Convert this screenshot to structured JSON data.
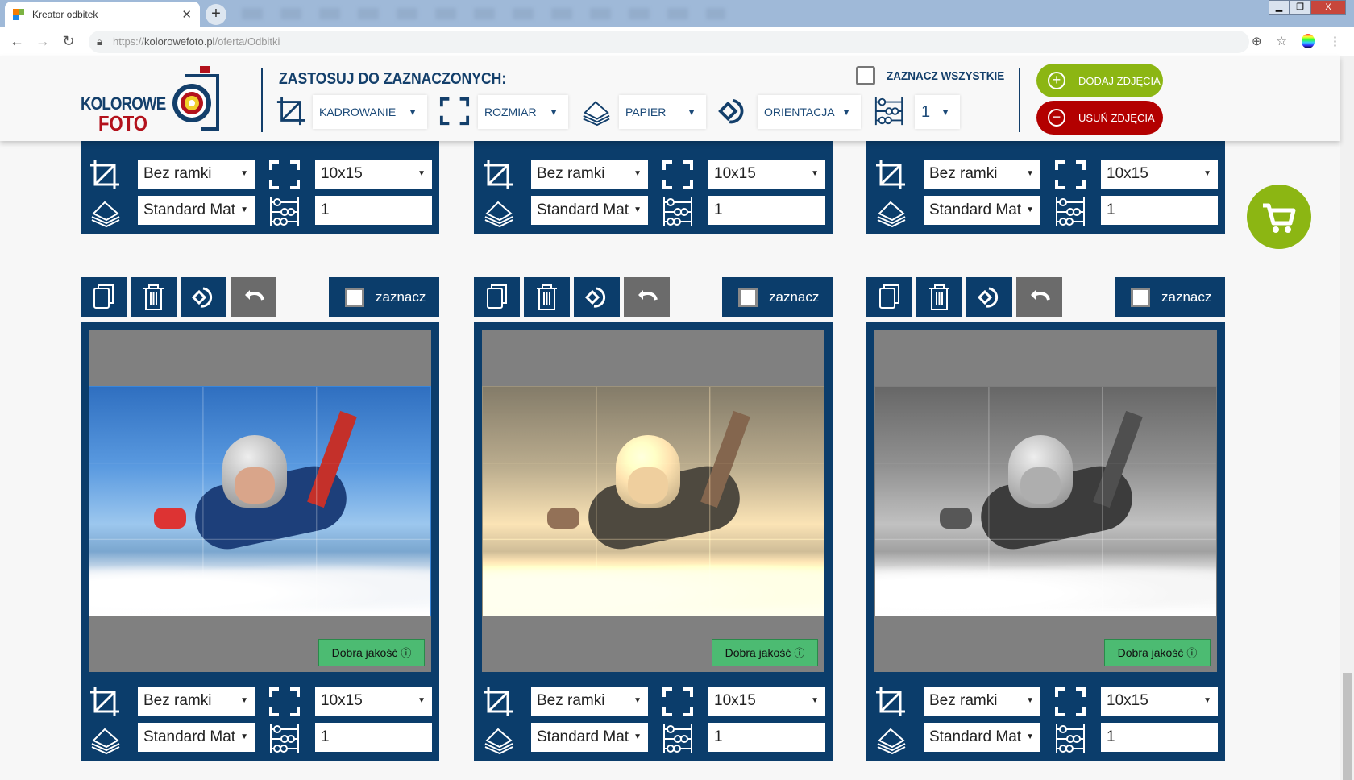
{
  "browser": {
    "tab_title": "Kreator odbitek",
    "url_scheme": "https://",
    "url_host": "kolorowefoto.pl",
    "url_path": "/oferta/Odbitki"
  },
  "logo": {
    "line1": "KOLOROWE",
    "line2": "FOTO"
  },
  "header": {
    "apply_title": "ZASTOSUJ DO ZAZNACZONYCH:",
    "crop_select": "KADROWANIE",
    "size_select": "ROZMIAR",
    "paper_select": "PAPIER",
    "orientation_select": "ORIENTACJA",
    "quantity": "1",
    "select_all": "ZAZNACZ WSZYSTKIE",
    "add_photos": "DODAJ ZDJĘCIA",
    "remove_photos": "USUŃ ZDJĘCIA"
  },
  "colors": {
    "navy": "#0b3d6b",
    "green": "#8cb613",
    "red": "#b30000",
    "quality": "#4cbb72"
  },
  "top_cards": [
    {
      "frame": "Bez ramki",
      "size": "10x15",
      "paper": "Standard Mat",
      "quantity": "1"
    },
    {
      "frame": "Bez ramki",
      "size": "10x15",
      "paper": "Standard Mat",
      "quantity": "1"
    },
    {
      "frame": "Bez ramki",
      "size": "10x15",
      "paper": "Standard Mat",
      "quantity": "1"
    }
  ],
  "cards": [
    {
      "select_label": "zaznacz",
      "quality": "Dobra jakość",
      "filter": "color",
      "frame": "Bez ramki",
      "size": "10x15",
      "paper": "Standard Mat",
      "quantity": "1"
    },
    {
      "select_label": "zaznacz",
      "quality": "Dobra jakość",
      "filter": "sepia",
      "frame": "Bez ramki",
      "size": "10x15",
      "paper": "Standard Mat",
      "quantity": "1"
    },
    {
      "select_label": "zaznacz",
      "quality": "Dobra jakość",
      "filter": "grayscale",
      "frame": "Bez ramki",
      "size": "10x15",
      "paper": "Standard Mat",
      "quantity": "1"
    }
  ]
}
